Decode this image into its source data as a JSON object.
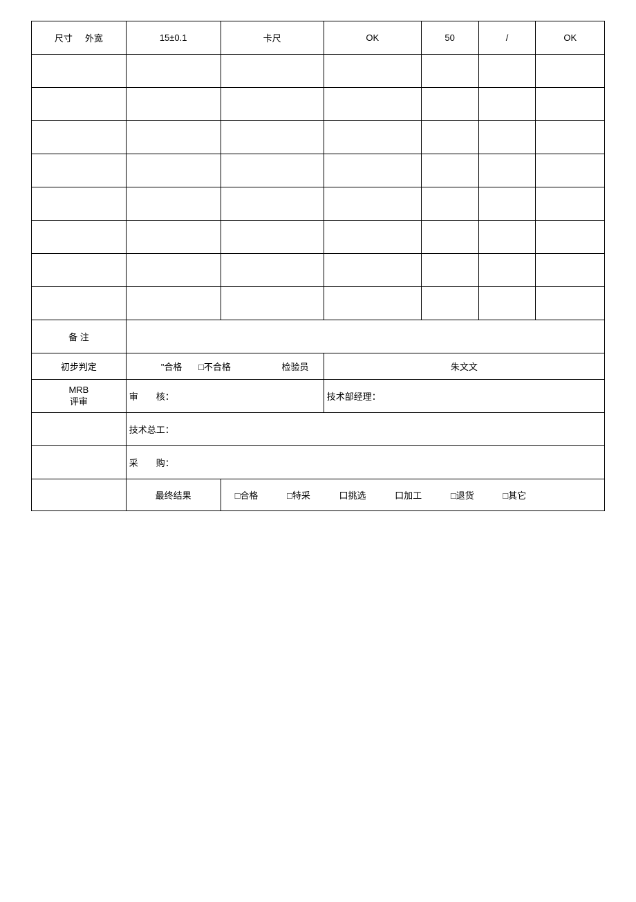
{
  "header": {
    "col1a": "尺寸",
    "col1b": "外宽",
    "col2": "15±0.1",
    "col3": "卡尺",
    "col4": "OK",
    "col5": "50",
    "col6": "/",
    "col7": "OK"
  },
  "remarks": {
    "label": "备 注"
  },
  "prelim": {
    "label": "初步判定",
    "opt_pass": "\"合格",
    "opt_fail": "□不合格",
    "inspector_label": "检验员",
    "inspector_name": "朱文文"
  },
  "mrb": {
    "label1": "MRB",
    "label2": "评审",
    "reviewer": "审　　核：",
    "tech_mgr": "技术部经理：",
    "tech_chief": "技术总工：",
    "purchase": "采　　购："
  },
  "final": {
    "label": "最终结果",
    "options": [
      "□合格",
      "□特采",
      "口挑选",
      "口加工",
      "□退货",
      "□其它"
    ]
  }
}
